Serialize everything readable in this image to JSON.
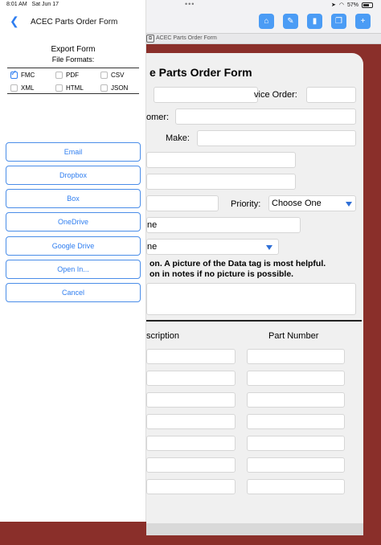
{
  "status": {
    "time": "8:01 AM",
    "date": "Sat Jun 17",
    "battery": "57%"
  },
  "panel": {
    "title": "ACEC Parts Order Form",
    "export_title": "Export Form",
    "file_formats_label": "File Formats:",
    "formats": [
      {
        "label": "FMC",
        "checked": true
      },
      {
        "label": "PDF",
        "checked": false
      },
      {
        "label": "CSV",
        "checked": false
      },
      {
        "label": "XML",
        "checked": false
      },
      {
        "label": "HTML",
        "checked": false
      },
      {
        "label": "JSON",
        "checked": false
      }
    ],
    "buttons": [
      "Email",
      "Dropbox",
      "Box",
      "OneDrive",
      "Google Drive",
      "Open In...",
      "Cancel"
    ]
  },
  "document": {
    "tab_title": "ACEC Parts Order Form",
    "form_title": "e Parts Order Form",
    "labels": {
      "service_order": "vice Order:",
      "customer": "omer:",
      "make": "Make:",
      "priority": "Priority:"
    },
    "priority_value": "Choose One",
    "select1_value": "ne",
    "select2_value": "ne",
    "note_line1": "on. A picture of the Data tag is most helpful.",
    "note_line2": "on in notes if no picture is possible.",
    "col_description": "scription",
    "col_part_number": "Part Number"
  },
  "colors": {
    "accent": "#2f7ef0",
    "toolbar_button": "#4b9cf5",
    "background": "#8a2f2a"
  }
}
